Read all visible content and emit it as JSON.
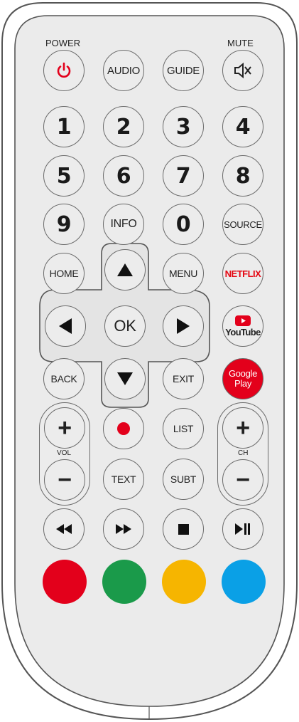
{
  "top_labels": {
    "power": "POWER",
    "mute": "MUTE"
  },
  "row1": {
    "audio": "AUDIO",
    "guide": "GUIDE"
  },
  "numbers": [
    "1",
    "2",
    "3",
    "4",
    "5",
    "6",
    "7",
    "8",
    "9",
    "0"
  ],
  "row_info": {
    "info": "INFO",
    "source": "SOURCE"
  },
  "nav": {
    "home": "HOME",
    "menu": "MENU",
    "ok": "OK",
    "back": "BACK",
    "exit": "EXIT"
  },
  "apps": {
    "netflix": "NETFLIX",
    "youtube": "YouTube",
    "google_play_line1": "Google",
    "google_play_line2": "Play"
  },
  "volume": {
    "label": "VOL",
    "plus": "+",
    "minus": "−"
  },
  "channel": {
    "label": "CH",
    "plus": "+",
    "minus": "−"
  },
  "middle": {
    "list": "LIST",
    "text": "TEXT",
    "subt": "SUBT"
  },
  "colors": {
    "red": "#e3001b",
    "green": "#1a9a4a",
    "yellow": "#f6b500",
    "blue": "#0aa0e6",
    "netflix": "#e50914",
    "google_play_bg": "#e3001b"
  },
  "icons": [
    "power-icon",
    "mute-icon",
    "up-arrow-icon",
    "down-arrow-icon",
    "left-arrow-icon",
    "right-arrow-icon",
    "record-icon",
    "rewind-icon",
    "fast-forward-icon",
    "stop-icon",
    "play-pause-icon",
    "youtube-icon"
  ]
}
